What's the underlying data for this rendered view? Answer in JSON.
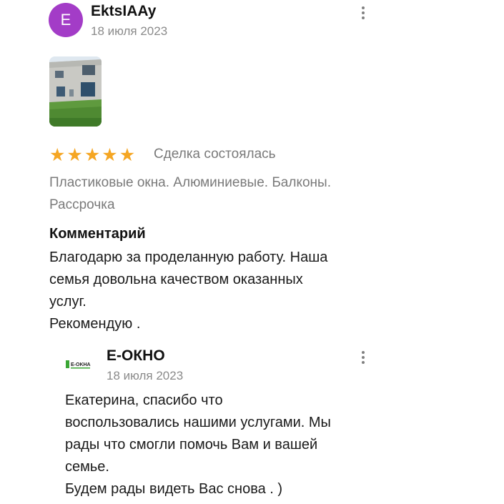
{
  "review": {
    "avatar_letter": "E",
    "avatar_color": "#a33cc7",
    "author": "EktsIAAy",
    "date": "18 июля 2023",
    "menu_icon": "more-vertical-icon",
    "rating": 5,
    "rating_max": 5,
    "star_color": "#f5a623",
    "deal_status": "Сделка состоялась",
    "tags": "Пластиковые окна. Алюминиевые. Балконы. Рассрочка",
    "comment_title": "Комментарий",
    "comment": "Благодарю за проделанную работу. Наша\nсемья довольна качеством оказанных\nуслуг.\nРекомендую ."
  },
  "reply": {
    "logo_text": "E-OKHA",
    "author": "Е-ОКНО",
    "date": "18 июля 2023",
    "menu_icon": "more-vertical-icon",
    "text": "Екатерина, спасибо что\nвоспользовались нашими услугами. Мы\nрады что смогли помочь Вам и вашей\nсемье.\nБудем рады видеть Вас снова . )"
  }
}
